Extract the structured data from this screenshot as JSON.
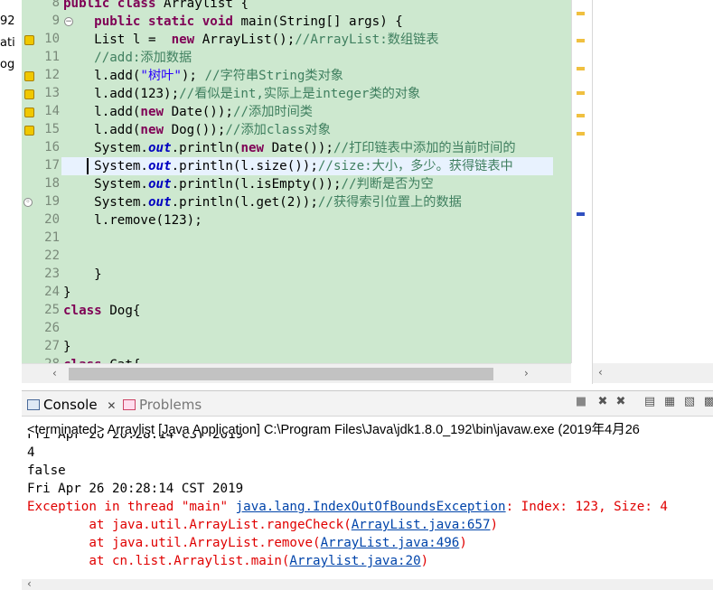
{
  "left_fragments": [
    "92",
    "ati",
    "og"
  ],
  "editor": {
    "lines": [
      {
        "num": "8",
        "tokens": [
          [
            "kw",
            "public class "
          ],
          [
            "",
            "Arraylist {"
          ]
        ]
      },
      {
        "num": "9",
        "tokens": [
          [
            "",
            "    "
          ],
          [
            "kw",
            "public static void "
          ],
          [
            "",
            "main(String[] args) {"
          ]
        ]
      },
      {
        "num": "10",
        "tokens": [
          [
            "",
            "    List l =  "
          ],
          [
            "kw",
            "new "
          ],
          [
            "",
            "ArrayList();"
          ],
          [
            "cm",
            "//ArrayList:数组链表"
          ]
        ]
      },
      {
        "num": "11",
        "tokens": [
          [
            "",
            "    "
          ],
          [
            "cm",
            "//add:添加数据"
          ]
        ]
      },
      {
        "num": "12",
        "tokens": [
          [
            "",
            "    l.add("
          ],
          [
            "str",
            "\"树叶\""
          ],
          [
            "",
            "); "
          ],
          [
            "cm",
            "//字符串String类对象"
          ]
        ]
      },
      {
        "num": "13",
        "tokens": [
          [
            "",
            "    l.add(123);"
          ],
          [
            "cm",
            "//看似是int,实际上是integer类的对象"
          ]
        ]
      },
      {
        "num": "14",
        "tokens": [
          [
            "",
            "    l.add("
          ],
          [
            "kw",
            "new "
          ],
          [
            "",
            "Date());"
          ],
          [
            "cm",
            "//添加时间类"
          ]
        ]
      },
      {
        "num": "15",
        "tokens": [
          [
            "",
            "    l.add("
          ],
          [
            "kw",
            "new "
          ],
          [
            "",
            "Dog());"
          ],
          [
            "cm",
            "//添加class对象"
          ]
        ]
      },
      {
        "num": "16",
        "tokens": [
          [
            "",
            "    System."
          ],
          [
            "fld",
            "out"
          ],
          [
            "",
            ".println("
          ],
          [
            "kw",
            "new "
          ],
          [
            "",
            "Date());"
          ],
          [
            "cm",
            "//打印链表中添加的当前时间的"
          ]
        ]
      },
      {
        "num": "17",
        "tokens": [
          [
            "",
            "    System."
          ],
          [
            "fld",
            "out"
          ],
          [
            "",
            ".println(l.size());"
          ],
          [
            "cm",
            "//size:大小，多少。获得链表中"
          ]
        ]
      },
      {
        "num": "18",
        "tokens": [
          [
            "",
            "    System."
          ],
          [
            "fld",
            "out"
          ],
          [
            "",
            ".println(l.isEmpty());"
          ],
          [
            "cm",
            "//判断是否为空"
          ]
        ]
      },
      {
        "num": "19",
        "tokens": [
          [
            "",
            "    System."
          ],
          [
            "fld",
            "out"
          ],
          [
            "",
            ".println(l.get(2));"
          ],
          [
            "cm",
            "//获得索引位置上的数据"
          ]
        ]
      },
      {
        "num": "20",
        "tokens": [
          [
            "",
            "    l.remove(123);"
          ]
        ]
      },
      {
        "num": "21",
        "tokens": [
          [
            "",
            ""
          ]
        ]
      },
      {
        "num": "22",
        "tokens": [
          [
            "",
            ""
          ]
        ]
      },
      {
        "num": "23",
        "tokens": [
          [
            "",
            "    }"
          ]
        ]
      },
      {
        "num": "24",
        "tokens": [
          [
            "",
            "}"
          ]
        ]
      },
      {
        "num": "25",
        "tokens": [
          [
            "kw",
            "class "
          ],
          [
            "",
            "Dog{"
          ]
        ]
      },
      {
        "num": "26",
        "tokens": [
          [
            "",
            ""
          ]
        ]
      },
      {
        "num": "27",
        "tokens": [
          [
            "",
            "}"
          ]
        ]
      },
      {
        "num": "28",
        "tokens": [
          [
            "kw",
            "class "
          ],
          [
            "",
            "Cat{"
          ]
        ]
      }
    ]
  },
  "console": {
    "tab_console": "Console",
    "tab_console_close": "✕",
    "tab_problems": "Problems",
    "description": "<terminated> Arraylist [Java Application] C:\\Program Files\\Java\\jdk1.8.0_192\\bin\\javaw.exe (2019年4月26",
    "output": [
      {
        "type": "normal",
        "text": "Fri Apr 26 20:28:14 CST 2019"
      },
      {
        "type": "normal",
        "text": "4"
      },
      {
        "type": "normal",
        "text": "false"
      },
      {
        "type": "normal",
        "text": "Fri Apr 26 20:28:14 CST 2019"
      },
      {
        "type": "exception",
        "pre": "Exception in thread \"main\" ",
        "link": "java.lang.IndexOutOfBoundsException",
        "post": ": Index: 123, Size: 4"
      },
      {
        "type": "trace",
        "pre": "        at java.util.ArrayList.rangeCheck(",
        "link": "ArrayList.java:657",
        "post": ")"
      },
      {
        "type": "trace",
        "pre": "        at java.util.ArrayList.remove(",
        "link": "ArrayList.java:496",
        "post": ")"
      },
      {
        "type": "trace",
        "pre": "        at cn.list.Arraylist.main(",
        "link": "Arraylist.java:20",
        "post": ")"
      }
    ]
  },
  "colors": {
    "editor_bg": "#cde8cf",
    "keyword": "#7f0055",
    "comment": "#3f7f5f",
    "string": "#2a00ff",
    "field": "#0000c0",
    "error": "#e00000",
    "link": "#0044aa"
  }
}
